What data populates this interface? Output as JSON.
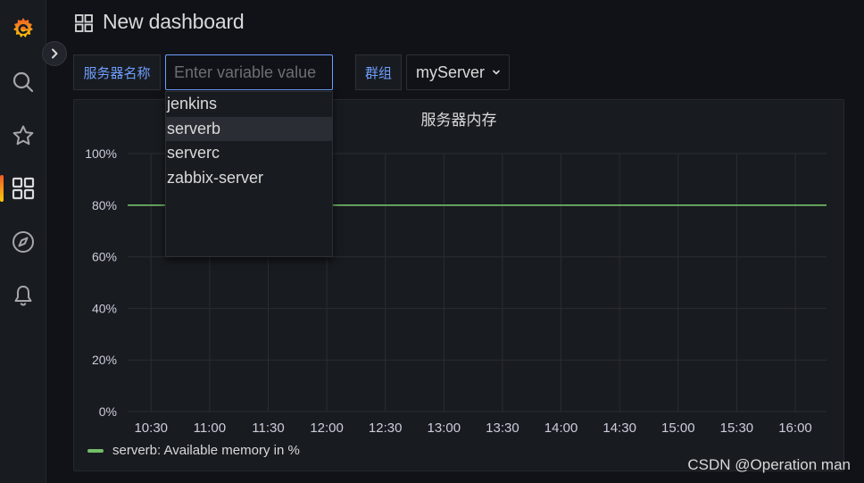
{
  "header": {
    "title": "New dashboard"
  },
  "sidebar": {
    "items": [
      {
        "name": "grafana-logo",
        "icon": "grafana-logo-icon"
      },
      {
        "name": "search",
        "icon": "search-icon"
      },
      {
        "name": "starred",
        "icon": "star-icon"
      },
      {
        "name": "dashboards",
        "icon": "dashboards-grid-icon",
        "active": true
      },
      {
        "name": "explore",
        "icon": "compass-icon"
      },
      {
        "name": "alerting",
        "icon": "bell-icon"
      }
    ],
    "expand_icon": "chevron-right-icon"
  },
  "variables": {
    "server_name": {
      "label": "服务器名称",
      "placeholder": "Enter variable value",
      "value": "",
      "options": [
        "jenkins",
        "serverb",
        "serverc",
        "zabbix-server"
      ],
      "hovered_option": "serverb"
    },
    "group": {
      "label": "群组",
      "value": "myServer"
    }
  },
  "panel": {
    "title": "服务器内存"
  },
  "chart_data": {
    "type": "line",
    "title": "服务器内存",
    "x": [
      "10:30",
      "11:00",
      "11:30",
      "12:00",
      "12:30",
      "13:00",
      "13:30",
      "14:00",
      "14:30",
      "15:00",
      "15:30",
      "16:00"
    ],
    "x_range": [
      "10:18",
      "16:16"
    ],
    "y_ticks": [
      "0%",
      "20%",
      "40%",
      "60%",
      "80%",
      "100%"
    ],
    "ylim": [
      0,
      100
    ],
    "grid": true,
    "legend_position": "bottom-left",
    "series": [
      {
        "name": "serverb: Available memory in %",
        "color": "#73bf69",
        "points": [
          [
            "10:18",
            80
          ],
          [
            "16:16",
            80
          ]
        ]
      }
    ]
  },
  "colors": {
    "accent": "#6e9fff",
    "series": "#73bf69",
    "background": "#111217",
    "panel": "#181b1f"
  },
  "watermark": "CSDN @Operation man"
}
